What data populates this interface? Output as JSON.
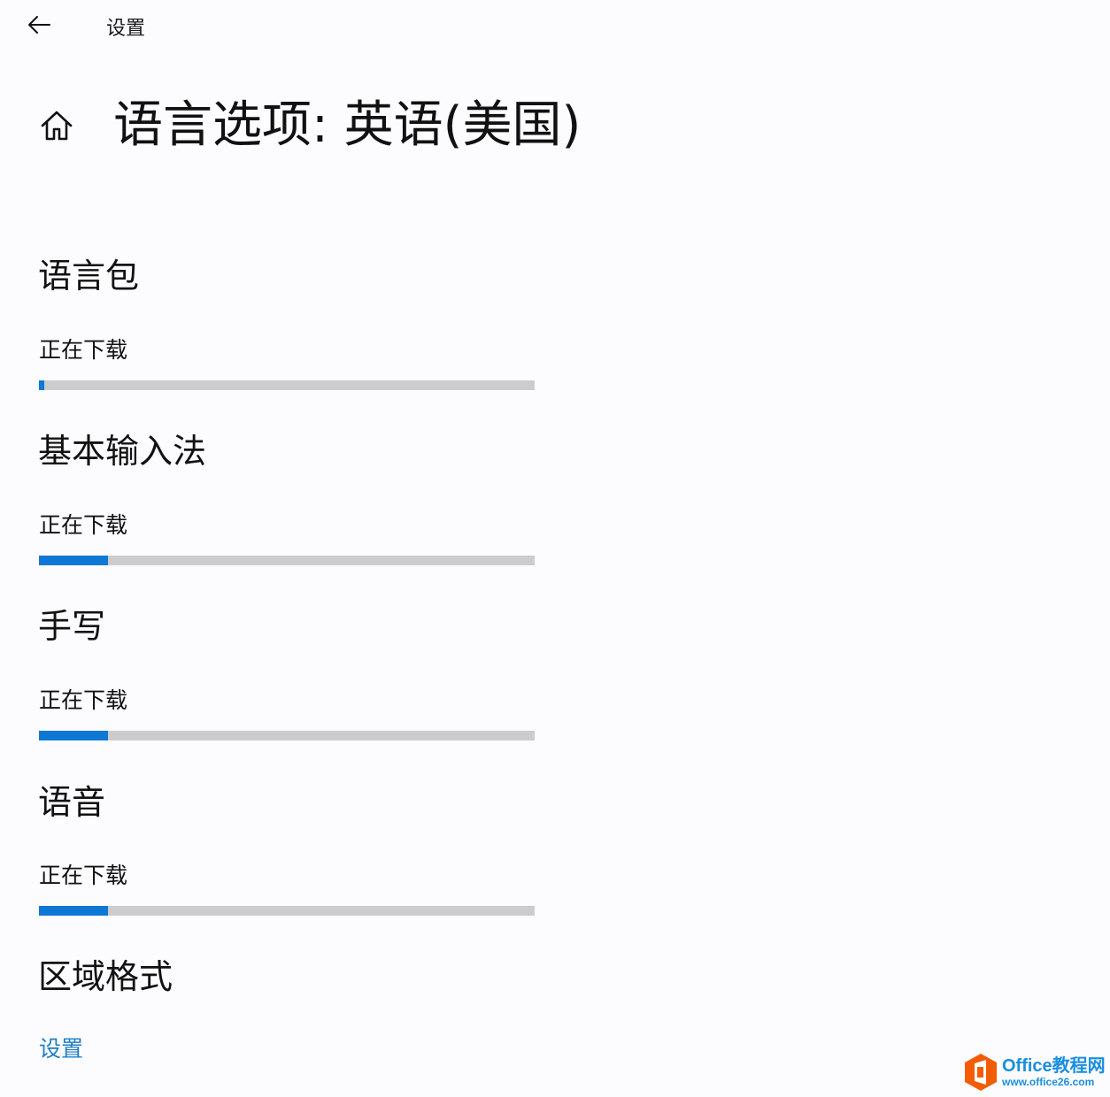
{
  "header": {
    "back_icon": "arrow-left-icon",
    "app_title": "设置"
  },
  "page": {
    "home_icon": "home-icon",
    "title": "语言选项: 英语(美国)"
  },
  "sections": [
    {
      "title": "语言包",
      "status": "正在下载",
      "progress": 0.01
    },
    {
      "title": "基本输入法",
      "status": "正在下载",
      "progress": 0.14
    },
    {
      "title": "手写",
      "status": "正在下载",
      "progress": 0.14
    },
    {
      "title": "语音",
      "status": "正在下载",
      "progress": 0.14
    }
  ],
  "regional_format": {
    "title": "区域格式",
    "link_label": "设置"
  },
  "watermark": {
    "brand": "Office教程网",
    "url": "www.office26.com"
  },
  "colors": {
    "progress_fill": "#0f78d4",
    "progress_track": "#cccccc",
    "link": "#1f7fc3",
    "background": "#fcfbfd",
    "watermark_orange": "#f25c05",
    "watermark_blue": "#1a8fe0"
  }
}
